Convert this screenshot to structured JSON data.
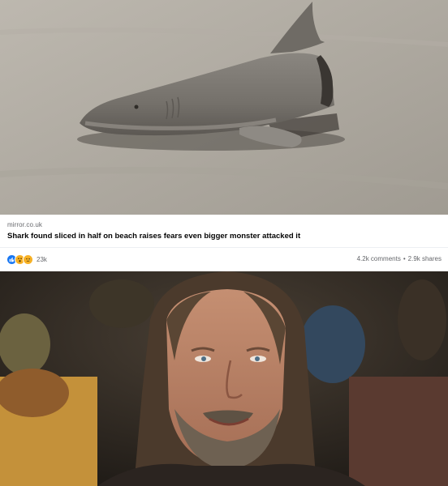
{
  "top_image": {
    "icon": "shark-photo"
  },
  "link_preview": {
    "source": "mirror.co.uk",
    "headline": "Shark found sliced in half on beach raises fears even bigger monster attacked it",
    "reaction_count": "23k",
    "comments": "4.2k comments",
    "separator": "•",
    "shares": "2.9k shares",
    "reaction_icons": [
      "like-reaction-icon",
      "wow-reaction-icon",
      "sad-reaction-icon"
    ],
    "colors": {
      "like": "#1877f2",
      "emoji": "#f7b125",
      "meta_text": "#65676b"
    }
  },
  "bottom_image": {
    "icon": "bearded-man-smiling-photo"
  }
}
